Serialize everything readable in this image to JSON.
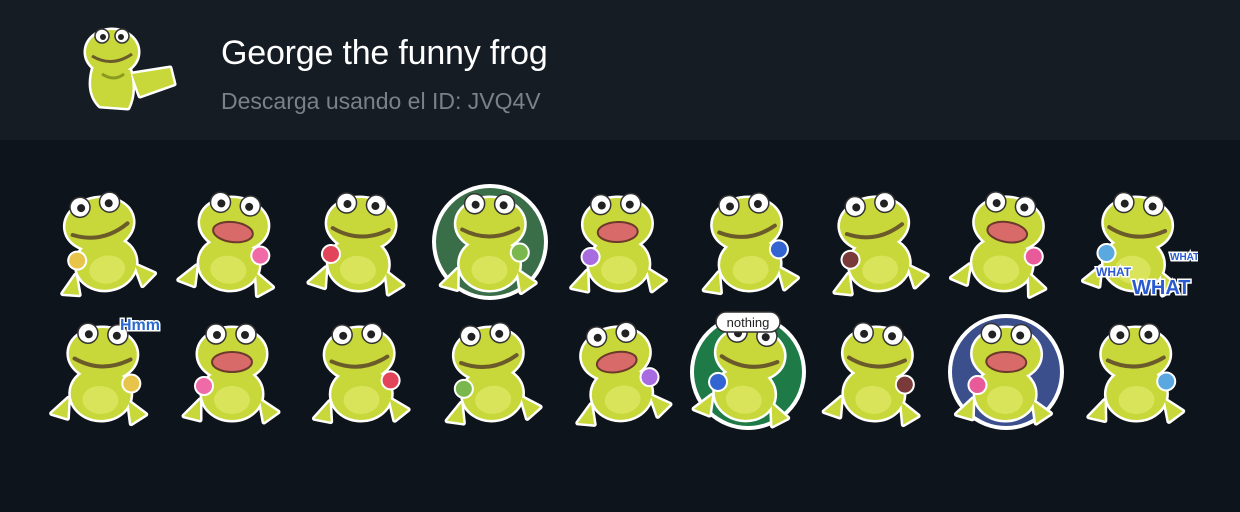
{
  "pack": {
    "title": "George the funny frog",
    "id_line": "Descarga usando el ID: JVQ4V",
    "thumbnail_icon": "frog-sticker-icon"
  },
  "colors": {
    "background": "#0e141b",
    "header_background": "#151c24",
    "title": "#ffffff",
    "subtitle": "#7a8189",
    "frog_green": "#c8d83a"
  },
  "stickers": [
    {
      "name": "frog-with-crown-sign-icon",
      "caption": ""
    },
    {
      "name": "frog-crying-in-float-icon",
      "caption": ""
    },
    {
      "name": "frog-holding-gift-icon",
      "caption": ""
    },
    {
      "name": "frog-dancing-circle-icon",
      "caption": ""
    },
    {
      "name": "frog-flower-necklace-icon",
      "caption": ""
    },
    {
      "name": "frog-bowtie-lying-icon",
      "caption": ""
    },
    {
      "name": "frog-monocle-wine-icon",
      "caption": ""
    },
    {
      "name": "frog-party-hat-icon",
      "caption": ""
    },
    {
      "name": "frog-what-what-icon",
      "caption": "WHAT WHAT WHAT"
    },
    {
      "name": "frog-hmm-icon",
      "caption": "Hmm"
    },
    {
      "name": "frog-pink-hat-kiss-icon",
      "caption": ""
    },
    {
      "name": "frog-arms-crossed-icon",
      "caption": ""
    },
    {
      "name": "frog-sitting-on-plates-icon",
      "caption": ""
    },
    {
      "name": "frog-shrug-icon",
      "caption": ""
    },
    {
      "name": "frog-nothing-pond-icon",
      "caption": "nothing"
    },
    {
      "name": "frog-in-reeds-icon",
      "caption": ""
    },
    {
      "name": "frog-sleeping-moon-icon",
      "caption": ""
    },
    {
      "name": "frog-on-stool-icon",
      "caption": ""
    }
  ]
}
